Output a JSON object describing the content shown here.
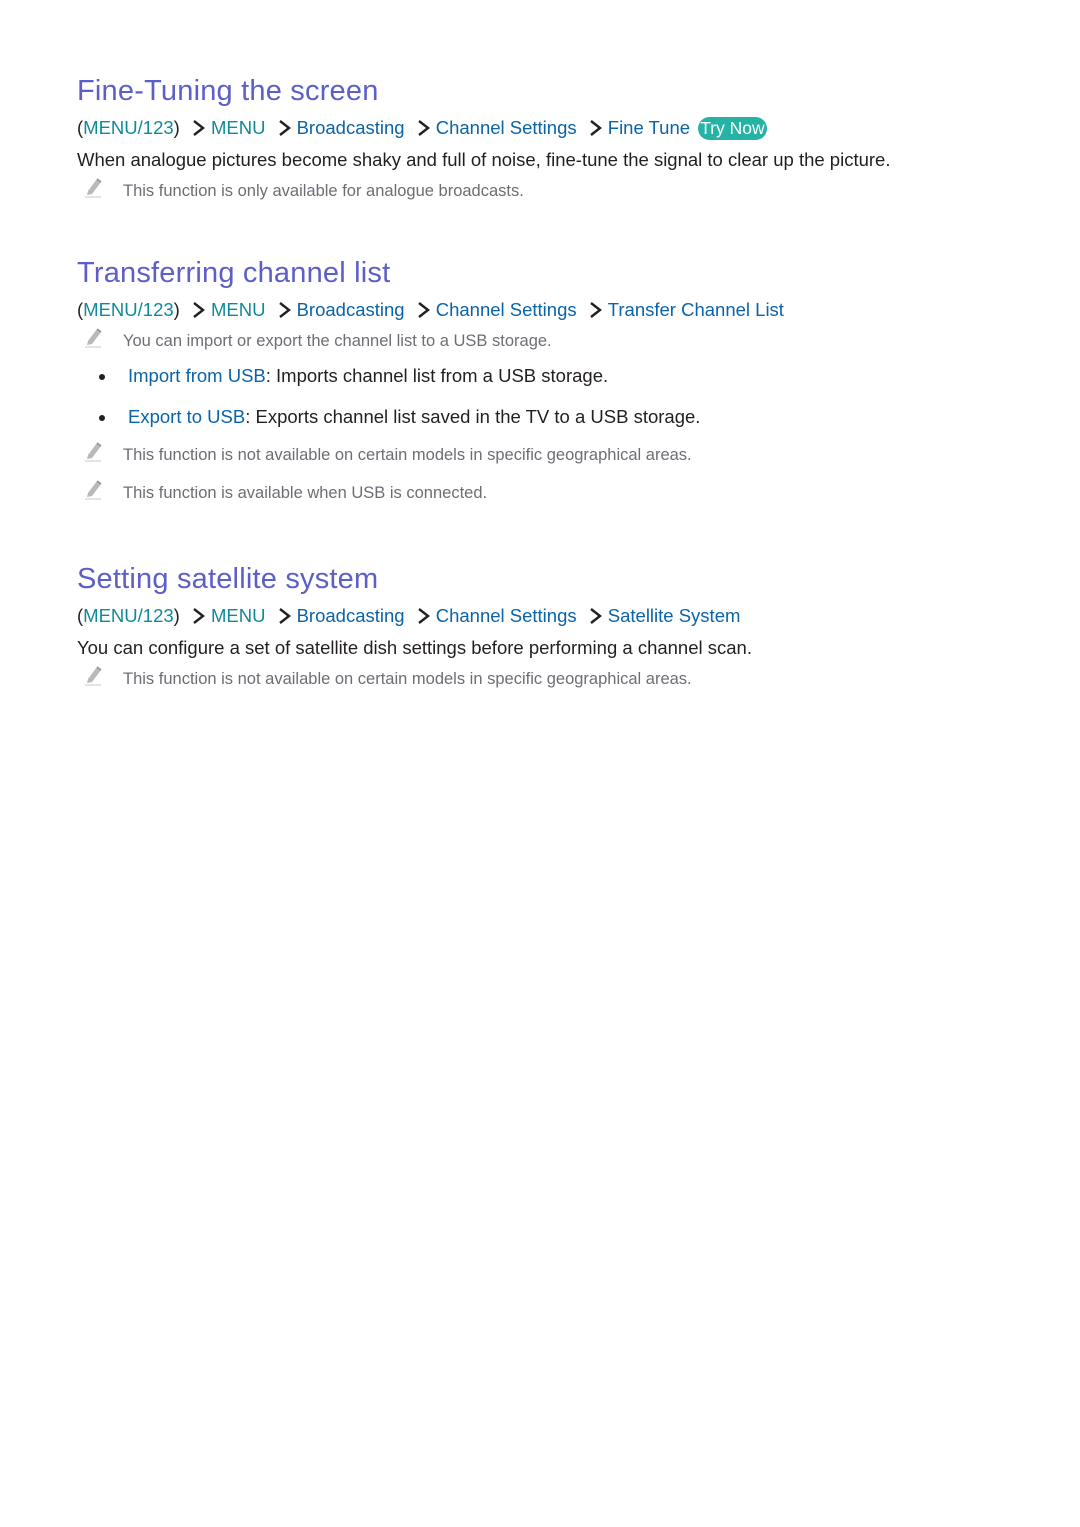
{
  "colors": {
    "heading": "#5b5fc7",
    "menu_key": "#0f8a9a",
    "menu_link": "#0b63a8",
    "body_text": "#231f20",
    "note_text": "#6d6e75",
    "try_now_bg": "#26b3a5"
  },
  "sections": [
    {
      "heading": "Fine-Tuning the screen",
      "path": {
        "open_paren": "(",
        "key": "MENU/123",
        "close_paren": ")",
        "items": [
          "MENU",
          "Broadcasting",
          "Channel Settings",
          "Fine Tune"
        ],
        "try_now": "Try Now"
      },
      "description": "When analogue pictures become shaky and full of noise, fine-tune the signal to clear up the picture.",
      "notes": [
        {
          "icon": "pencil-icon",
          "text": "This function is only available for analogue broadcasts."
        }
      ]
    },
    {
      "heading": "Transferring channel list",
      "path": {
        "open_paren": "(",
        "key": "MENU/123",
        "close_paren": ")",
        "items": [
          "MENU",
          "Broadcasting",
          "Channel Settings",
          "Transfer Channel List"
        ]
      },
      "notes_top": [
        {
          "icon": "pencil-icon",
          "text": "You can import or export the channel list to a USB storage."
        }
      ],
      "bullets": [
        {
          "term": "Import from USB",
          "sep": ": ",
          "text": "Imports channel list from a USB storage."
        },
        {
          "term": "Export to USB",
          "sep": ": ",
          "text": "Exports channel list saved in the TV to a USB storage."
        }
      ],
      "notes": [
        {
          "icon": "pencil-icon",
          "text": "This function is not available on certain models in specific geographical areas."
        },
        {
          "icon": "pencil-icon",
          "text": "This function is available when USB is connected."
        }
      ]
    },
    {
      "heading": "Setting satellite system",
      "path": {
        "open_paren": "(",
        "key": "MENU/123",
        "close_paren": ")",
        "items": [
          "MENU",
          "Broadcasting",
          "Channel Settings",
          "Satellite System"
        ]
      },
      "description": "You can configure a set of satellite dish settings before performing a channel scan.",
      "notes": [
        {
          "icon": "pencil-icon",
          "text": "This function is not available on certain models in specific geographical areas."
        }
      ]
    }
  ]
}
